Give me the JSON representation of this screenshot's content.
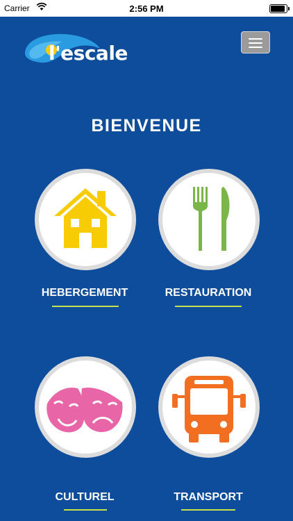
{
  "status_bar": {
    "carrier": "Carrier",
    "time": "2:56 PM"
  },
  "header": {
    "logo_text": "l'escale",
    "menu_icon": "hamburger-menu-icon"
  },
  "main": {
    "title": "BIENVENUE",
    "tiles": [
      {
        "label": "HEBERGEMENT",
        "icon": "house-icon",
        "icon_color": "#f7cc05"
      },
      {
        "label": "RESTAURATION",
        "icon": "fork-knife-icon",
        "icon_color": "#7ab648"
      },
      {
        "label": "CULTUREL",
        "icon": "theater-masks-icon",
        "icon_color": "#e866a8"
      },
      {
        "label": "TRANSPORT",
        "icon": "bus-icon",
        "icon_color": "#f26e21"
      }
    ]
  },
  "colors": {
    "background": "#0d4d9c",
    "underline": "#c8e04a",
    "circle_border": "#dcdcdc"
  }
}
